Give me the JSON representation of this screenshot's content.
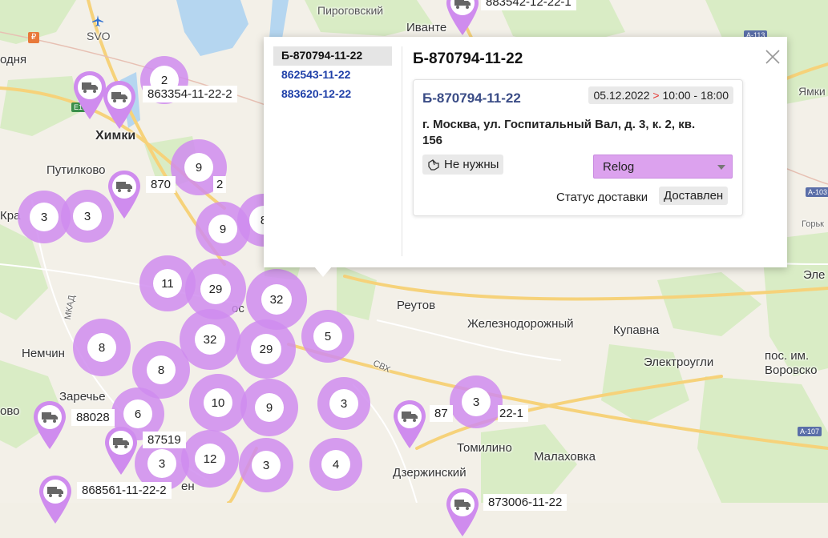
{
  "map": {
    "places": [
      {
        "name": "Химки",
        "kind": "big"
      },
      {
        "name": "Путилково",
        "kind": "mid"
      },
      {
        "name": "Реутов",
        "kind": "mid"
      },
      {
        "name": "Железнодорожный",
        "kind": "mid"
      },
      {
        "name": "Купавна",
        "kind": "mid"
      },
      {
        "name": "Электроугли",
        "kind": "mid"
      },
      {
        "name": "пос. им.",
        "kind": "mid"
      },
      {
        "name": "Воровско",
        "kind": "mid"
      },
      {
        "name": "Немчин",
        "kind": "mid"
      },
      {
        "name": "Заречье",
        "kind": "mid"
      },
      {
        "name": "Томилино",
        "kind": "mid"
      },
      {
        "name": "Малаховка",
        "kind": "mid"
      },
      {
        "name": "Дзержинский",
        "kind": "mid"
      },
      {
        "name": "Пироговский",
        "kind": "small"
      },
      {
        "name": "Иванте",
        "kind": "mid"
      },
      {
        "name": "одня",
        "kind": "mid"
      },
      {
        "name": "Кра",
        "kind": "mid"
      },
      {
        "name": "ово",
        "kind": "mid"
      },
      {
        "name": "Эле",
        "kind": "mid"
      },
      {
        "name": "Ямки",
        "kind": "small"
      },
      {
        "name": "Горьк",
        "kind": "tiny"
      },
      {
        "name": "МКАД",
        "kind": "tiny"
      },
      {
        "name": "СВХ",
        "kind": "tiny"
      },
      {
        "name": "SVO",
        "kind": "small"
      },
      {
        "name": "ос",
        "kind": "mid"
      },
      {
        "name": "ен",
        "kind": "mid"
      },
      {
        "name": "Ки",
        "kind": "mid"
      }
    ],
    "road_shields": [
      "А-113",
      "А-107",
      "E105",
      "А-103"
    ],
    "clusters": [
      "2",
      "9",
      "3",
      "3",
      "9",
      "8",
      "11",
      "29",
      "32",
      "32",
      "29",
      "5",
      "8",
      "8",
      "6",
      "10",
      "9",
      "3",
      "3",
      "3",
      "12",
      "3",
      "4"
    ],
    "pins": [
      {
        "label": "883542-12-22-1"
      },
      {
        "label": "863354-11-22-2"
      },
      {
        "label": "870"
      },
      {
        "label": "2"
      },
      {
        "label": "88028"
      },
      {
        "label": "87519"
      },
      {
        "label": "868561-11-22-2"
      },
      {
        "label": "87"
      },
      {
        "label": "22-1"
      },
      {
        "label": "873006-11-22"
      }
    ]
  },
  "popup": {
    "list": [
      {
        "label": "Б-870794-11-22",
        "active": true
      },
      {
        "label": "862543-11-22",
        "active": false
      },
      {
        "label": "883620-12-22",
        "active": false
      }
    ],
    "title": "Б-870794-11-22",
    "card": {
      "order": "Б-870794-11-22",
      "date": "05.12.2022",
      "arrow": ">",
      "time": "10:00 - 18:00",
      "address": "г. Москва, ул. Госпитальный Вал, д. 3, к. 2, кв. 156",
      "not_needed": "Не нужны",
      "relog": "Relog",
      "status_label": "Статус доставки",
      "status_value": "Доставлен"
    }
  },
  "colors": {
    "cluster": "#cf8cee",
    "relog": "#dca2ee",
    "link": "#1e3fa8"
  }
}
